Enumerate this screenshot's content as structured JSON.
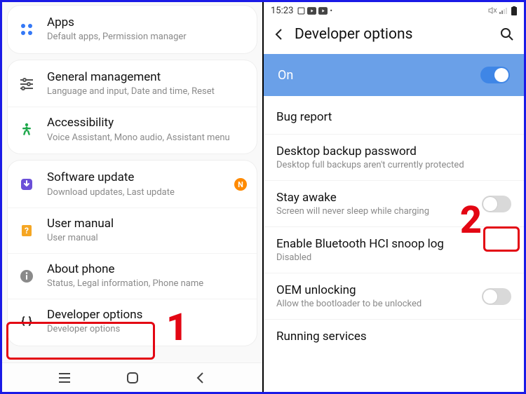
{
  "annotations": {
    "one": "1",
    "two": "2"
  },
  "left": {
    "apps": {
      "title": "Apps",
      "subtitle": "Default apps, Permission manager"
    },
    "general": {
      "title": "General management",
      "subtitle": "Language and input, Date and time, Reset"
    },
    "accessibility": {
      "title": "Accessibility",
      "subtitle": "Voice Assistant, Mono audio, Assistant menu"
    },
    "software_update": {
      "title": "Software update",
      "subtitle": "Download updates, Last update",
      "badge": "N"
    },
    "user_manual": {
      "title": "User manual",
      "subtitle": "User manual"
    },
    "about_phone": {
      "title": "About phone",
      "subtitle": "Status, Legal information, Phone name"
    },
    "developer_options": {
      "title": "Developer options",
      "subtitle": "Developer options"
    }
  },
  "right": {
    "status_time": "15:23",
    "header_title": "Developer options",
    "on_label": "On",
    "items": {
      "bug_report": {
        "title": "Bug report"
      },
      "desktop_backup": {
        "title": "Desktop backup password",
        "subtitle": "Desktop full backups aren't currently protected"
      },
      "stay_awake": {
        "title": "Stay awake",
        "subtitle": "Screen will never sleep while charging"
      },
      "hci_snoop": {
        "title": "Enable Bluetooth HCI snoop log",
        "subtitle": "Disabled"
      },
      "oem_unlock": {
        "title": "OEM unlocking",
        "subtitle": "Allow the bootloader to be unlocked"
      },
      "running_services": {
        "title": "Running services"
      }
    }
  }
}
